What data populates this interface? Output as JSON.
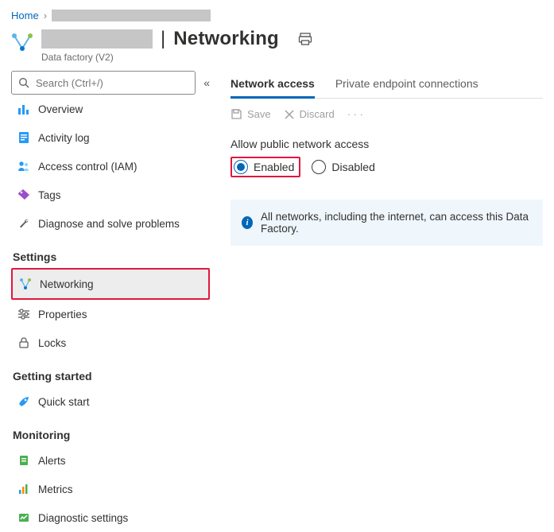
{
  "breadcrumb": {
    "home": "Home"
  },
  "header": {
    "title": "Networking",
    "subtype": "Data factory (V2)"
  },
  "sidebar": {
    "search_placeholder": "Search (Ctrl+/)",
    "items_top": [
      {
        "id": "overview",
        "label": "Overview"
      },
      {
        "id": "activity-log",
        "label": "Activity log"
      },
      {
        "id": "iam",
        "label": "Access control (IAM)"
      },
      {
        "id": "tags",
        "label": "Tags"
      },
      {
        "id": "diagnose",
        "label": "Diagnose and solve problems"
      }
    ],
    "section_settings": "Settings",
    "items_settings": [
      {
        "id": "networking",
        "label": "Networking",
        "selected": true
      },
      {
        "id": "properties",
        "label": "Properties"
      },
      {
        "id": "locks",
        "label": "Locks"
      }
    ],
    "section_getting_started": "Getting started",
    "items_getting_started": [
      {
        "id": "quick-start",
        "label": "Quick start"
      }
    ],
    "section_monitoring": "Monitoring",
    "items_monitoring": [
      {
        "id": "alerts",
        "label": "Alerts"
      },
      {
        "id": "metrics",
        "label": "Metrics"
      },
      {
        "id": "diag-settings",
        "label": "Diagnostic settings"
      }
    ]
  },
  "tabs": {
    "network_access": "Network access",
    "private_endpoint": "Private endpoint connections"
  },
  "toolbar": {
    "save": "Save",
    "discard": "Discard"
  },
  "form": {
    "allow_label": "Allow public network access",
    "enabled": "Enabled",
    "disabled": "Disabled"
  },
  "info": {
    "text": "All networks, including the internet, can access this Data Factory."
  }
}
